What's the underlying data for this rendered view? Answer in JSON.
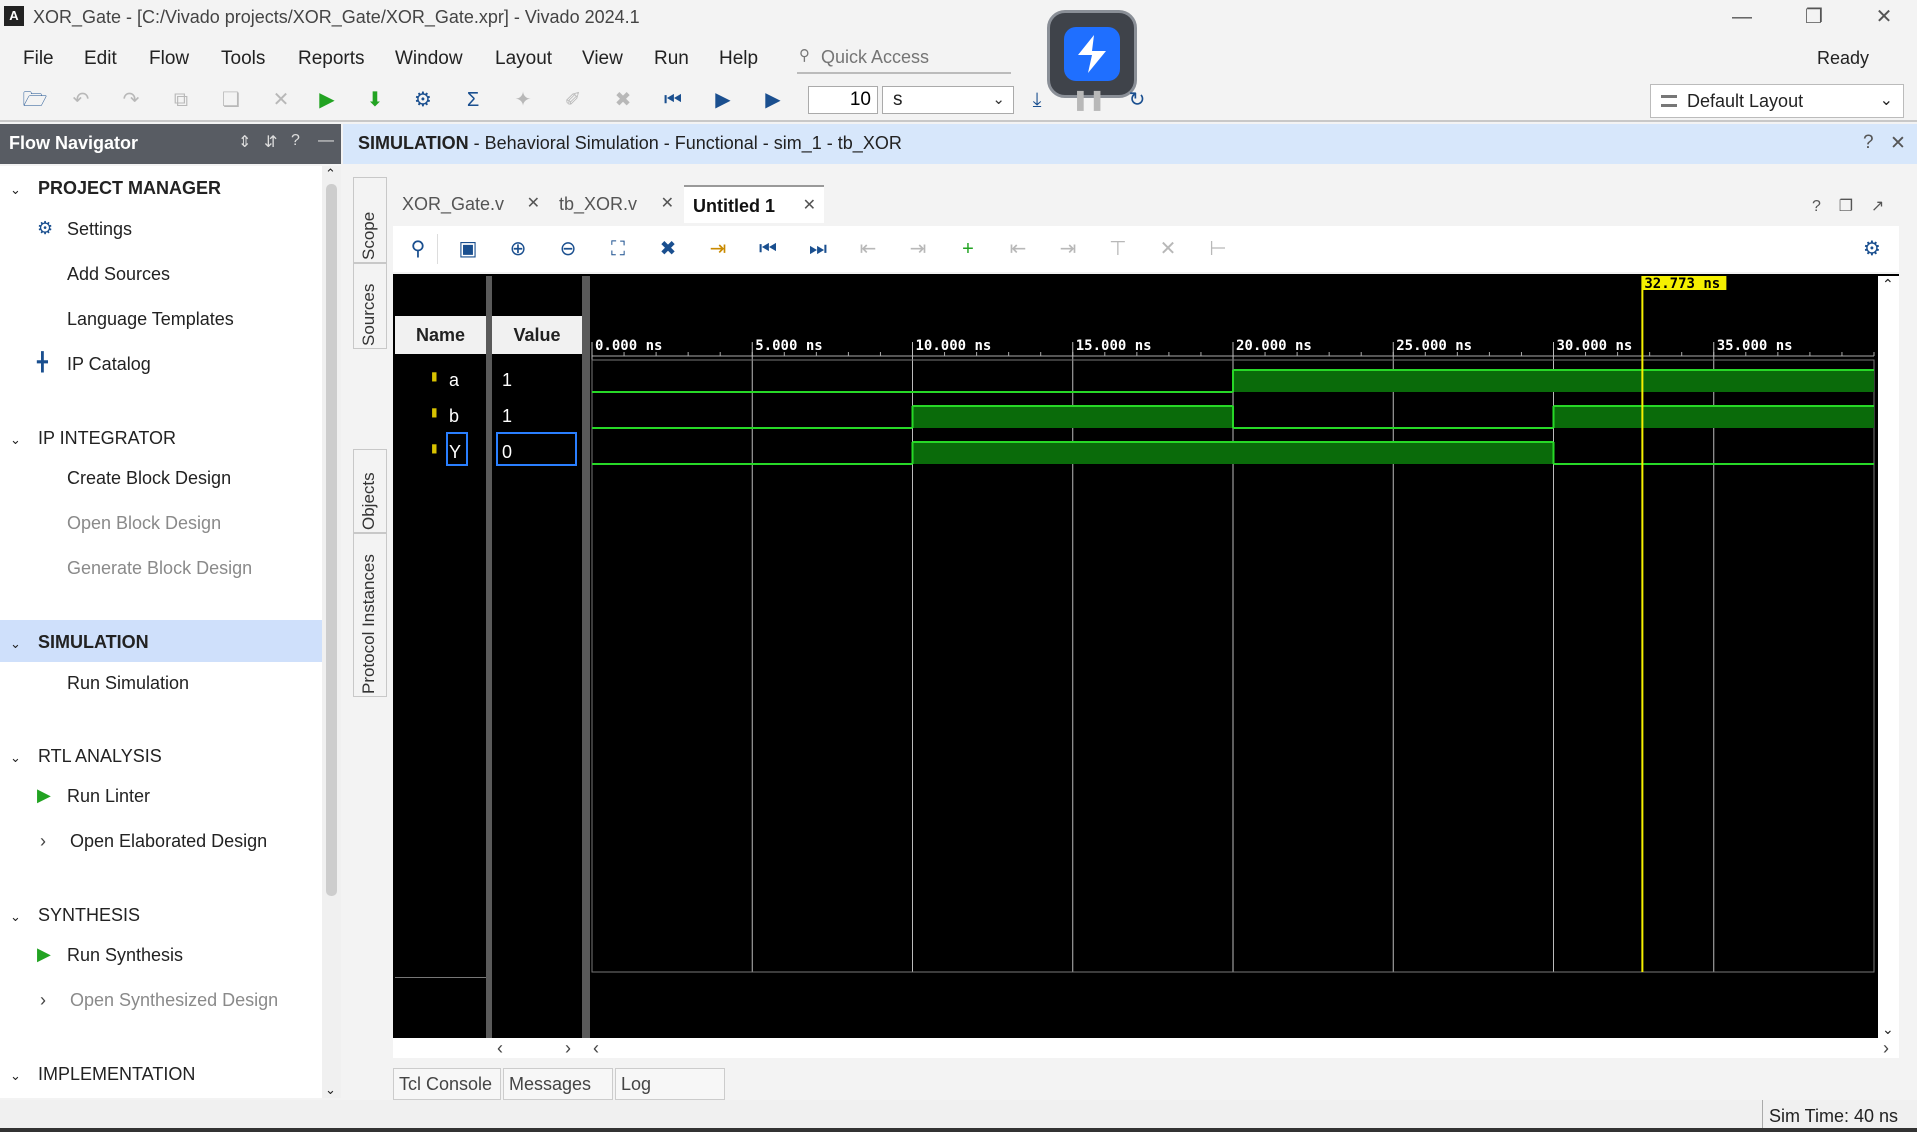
{
  "window": {
    "title": "XOR_Gate - [C:/Vivado projects/XOR_Gate/XOR_Gate.xpr] - Vivado 2024.1",
    "logo_glyph": "A",
    "status": "Ready"
  },
  "menu": [
    "File",
    "Edit",
    "Flow",
    "Tools",
    "Reports",
    "Window",
    "Layout",
    "View",
    "Run",
    "Help"
  ],
  "quick_access": {
    "placeholder": "Quick Access"
  },
  "toolbar": {
    "run_time": "10",
    "run_unit": "s",
    "layout": "Default Layout"
  },
  "flow_navigator": {
    "title": "Flow Navigator",
    "sections": {
      "project_manager": "PROJECT MANAGER",
      "ip_integrator": "IP INTEGRATOR",
      "simulation": "SIMULATION",
      "rtl_analysis": "RTL ANALYSIS",
      "synthesis": "SYNTHESIS",
      "implementation": "IMPLEMENTATION"
    },
    "items": {
      "settings": "Settings",
      "add_sources": "Add Sources",
      "language_templates": "Language Templates",
      "ip_catalog": "IP Catalog",
      "create_block_design": "Create Block Design",
      "open_block_design": "Open Block Design",
      "generate_block_design": "Generate Block Design",
      "run_simulation": "Run Simulation",
      "run_linter": "Run Linter",
      "open_elaborated_design": "Open Elaborated Design",
      "run_synthesis": "Run Synthesis",
      "open_synthesized_design": "Open Synthesized Design"
    }
  },
  "sim_header": {
    "label": "SIMULATION",
    "detail": " - Behavioral Simulation - Functional - sim_1 - tb_XOR"
  },
  "side_tabs": [
    "Scope",
    "Sources",
    "Objects",
    "Protocol Instances"
  ],
  "doc_tabs": [
    "XOR_Gate.v",
    "tb_XOR.v",
    "Untitled 1"
  ],
  "wave": {
    "name_header": "Name",
    "value_header": "Value",
    "cursor_label": "32.773 ns",
    "cursor_time": 32.773,
    "time_range": [
      0,
      40
    ],
    "ticks": [
      "0.000 ns",
      "5.000 ns",
      "10.000 ns",
      "15.000 ns",
      "20.000 ns",
      "25.000 ns",
      "30.000 ns",
      "35.000 ns"
    ],
    "tick_times": [
      0,
      5,
      10,
      15,
      20,
      25,
      30,
      35
    ],
    "signals": [
      {
        "name": "a",
        "value": "1",
        "transitions": [
          [
            0,
            0
          ],
          [
            20,
            1
          ]
        ]
      },
      {
        "name": "b",
        "value": "1",
        "transitions": [
          [
            0,
            0
          ],
          [
            10,
            1
          ],
          [
            20,
            0
          ],
          [
            30,
            1
          ]
        ]
      },
      {
        "name": "Y",
        "value": "0",
        "transitions": [
          [
            0,
            0
          ],
          [
            10,
            1
          ],
          [
            30,
            0
          ]
        ]
      }
    ]
  },
  "bottom_tabs": [
    "Tcl Console",
    "Messages",
    "Log"
  ],
  "status_bar": {
    "sim_time": "Sim Time: 40 ns"
  }
}
